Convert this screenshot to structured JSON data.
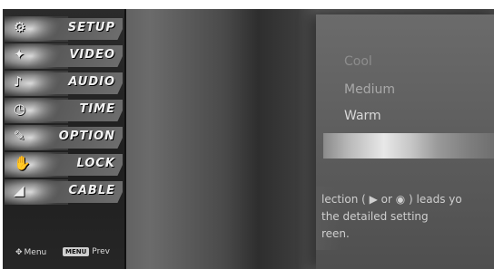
{
  "sidebar": {
    "items": [
      {
        "label": "SETUP",
        "icon": "setup-icon",
        "glyph": "⚙"
      },
      {
        "label": "VIDEO",
        "icon": "video-icon",
        "glyph": "✦"
      },
      {
        "label": "AUDIO",
        "icon": "audio-icon",
        "glyph": "♪"
      },
      {
        "label": "TIME",
        "icon": "clock-icon",
        "glyph": "◷"
      },
      {
        "label": "OPTION",
        "icon": "option-icon",
        "glyph": "✎"
      },
      {
        "label": "LOCK",
        "icon": "lock-icon",
        "glyph": "✋"
      },
      {
        "label": "CABLE",
        "icon": "cable-icon",
        "glyph": "◢"
      }
    ],
    "footer": {
      "menu_label": "Menu",
      "menu_icon": "dpad-icon",
      "menu_glyph": "✥",
      "prev_key": "MENU",
      "prev_label": "Prev"
    }
  },
  "panel": {
    "options": [
      "Cool",
      "Medium",
      "Warm"
    ],
    "help_text": "lection ( ▶ or ◉ ) leads yo\nthe detailed setting\nreen."
  },
  "colors": {
    "highlight": "#e8e8e8",
    "sidebar_bg": "#2b2b2b",
    "panel_bg": "#6b6b6b"
  }
}
